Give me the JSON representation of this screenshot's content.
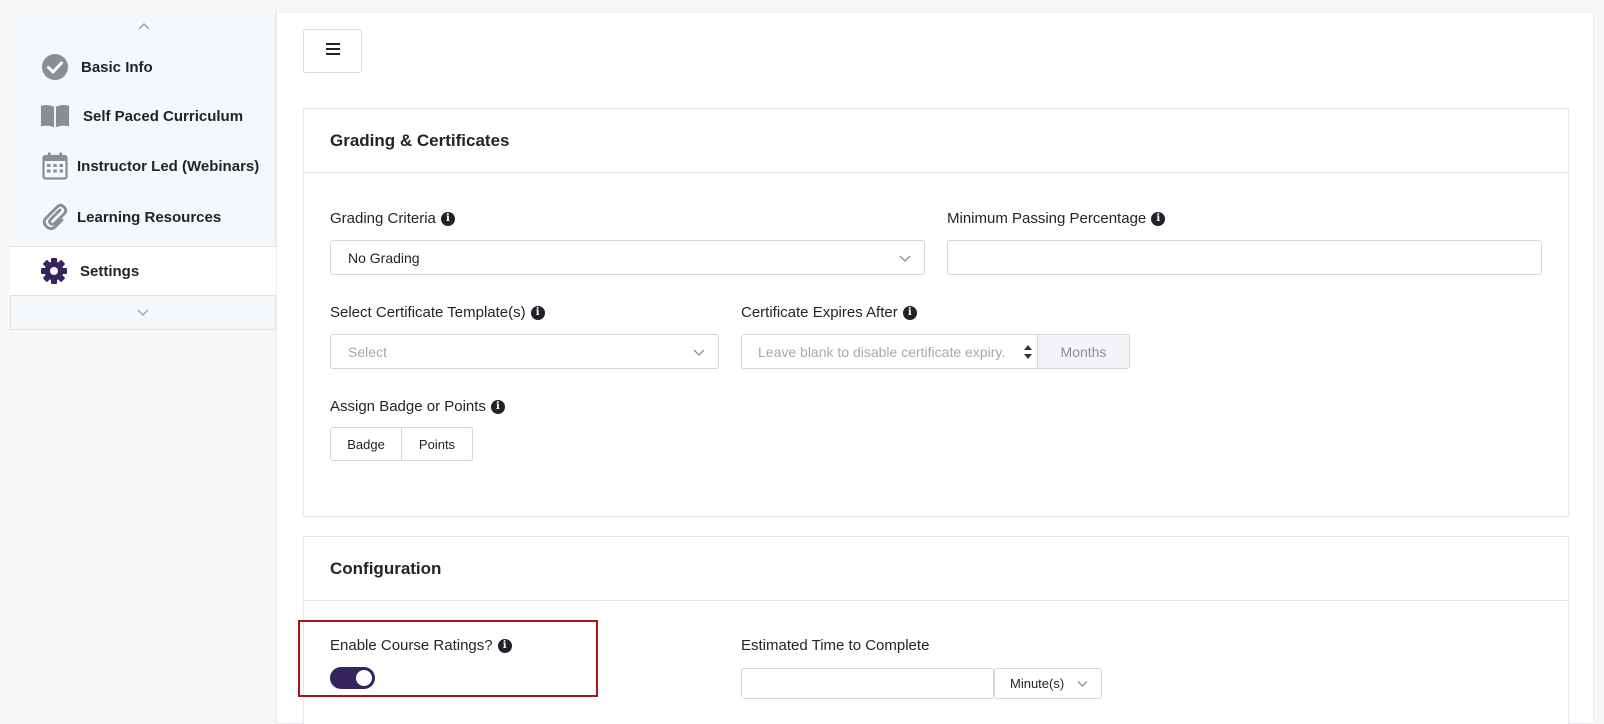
{
  "sidebar": {
    "items": [
      {
        "label": "Basic Info",
        "icon": "check-circle-icon"
      },
      {
        "label": "Self Paced Curriculum",
        "icon": "book-icon"
      },
      {
        "label": "Instructor Led (Webinars)",
        "icon": "calendar-icon"
      },
      {
        "label": "Learning Resources",
        "icon": "paperclip-icon"
      },
      {
        "label": "Settings",
        "icon": "gear-icon",
        "active": true
      }
    ]
  },
  "grading": {
    "title": "Grading & Certificates",
    "grading_criteria_label": "Grading Criteria",
    "grading_criteria_value": "No Grading",
    "min_pass_label": "Minimum Passing Percentage",
    "min_pass_value": "",
    "cert_template_label": "Select Certificate Template(s)",
    "cert_template_placeholder": "Select",
    "cert_expires_label": "Certificate Expires After",
    "cert_expires_placeholder": "Leave blank to disable certificate expiry.",
    "cert_expires_unit": "Months",
    "badge_label": "Assign Badge or Points",
    "badge_button": "Badge",
    "points_button": "Points"
  },
  "configuration": {
    "title": "Configuration",
    "ratings_label": "Enable Course Ratings?",
    "ratings_enabled": true,
    "est_time_label": "Estimated Time to Complete",
    "est_time_value": "",
    "est_time_unit": "Minute(s)"
  },
  "colors": {
    "accent": "#35245d",
    "highlight": "#a3171b",
    "icon_gray": "#8a8d92"
  }
}
